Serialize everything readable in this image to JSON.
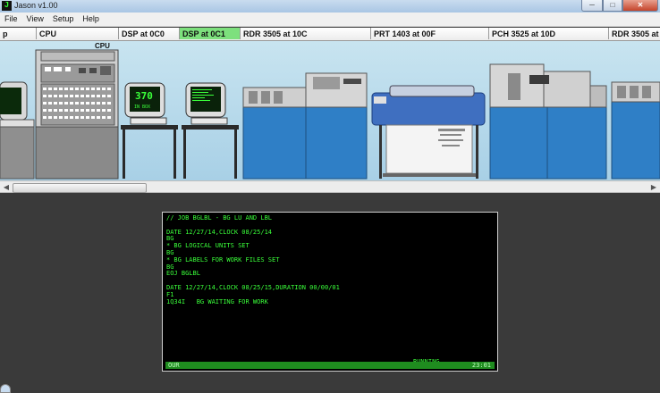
{
  "window": {
    "title": "Jason v1.00",
    "icon_letter": "J",
    "controls": [
      "min",
      "max",
      "close"
    ]
  },
  "menu": [
    "File",
    "View",
    "Setup",
    "Help"
  ],
  "devices": [
    {
      "label": "p",
      "active": false
    },
    {
      "label": "CPU",
      "active": false
    },
    {
      "label": "DSP at 0C0",
      "active": false
    },
    {
      "label": "DSP at 0C1",
      "active": true
    },
    {
      "label": "RDR 3505 at 10C",
      "active": false
    },
    {
      "label": "PRT 1403 at 00F",
      "active": false
    },
    {
      "label": "PCH 3525 at 10D",
      "active": false
    },
    {
      "label": "RDR 3505 at",
      "active": false
    }
  ],
  "scene": {
    "cpu_label": "CPU",
    "screen_text": {
      "line1": "370",
      "line2": "IN BOX"
    }
  },
  "colors": {
    "active_tab": "#7de07d",
    "terminal_text": "#3aff3a",
    "status_bar": "#1f8c1f",
    "machine_blue": "#2f7fc6"
  },
  "terminal": {
    "lines": [
      "// JOB BGLBL - BG LU AND LBL",
      "",
      "DATE 12/27/14,CLOCK 08/25/14",
      "BG",
      "* BG LOGICAL UNITS SET",
      "BG",
      "* BG LABELS FOR WORK FILES SET",
      "BG",
      "EOJ BGLBL",
      "",
      "DATE 12/27/14,CLOCK 08/25/15,DURATION 00/00/01",
      "F1",
      "1Q34I   BG WAITING FOR WORK"
    ],
    "status": "RUNNING",
    "bar_left": "OUR",
    "bar_right": "23:01"
  }
}
